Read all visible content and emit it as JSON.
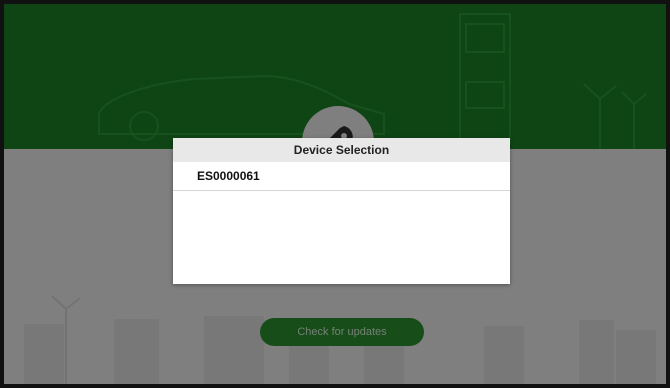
{
  "dialog": {
    "title": "Device Selection",
    "devices": [
      {
        "serial": "ES0000061"
      }
    ]
  },
  "background": {
    "update_button_label": "Check for updates",
    "icons": [
      "car-icon",
      "charging-station-icon",
      "wind-turbine-icon",
      "rocket-icon"
    ]
  },
  "colors": {
    "brand_green": "#1f8a2a",
    "button_green": "#2e9a33",
    "dialog_header_bg": "#e8e8e8",
    "overlay": "rgba(0,0,0,0.5)"
  }
}
